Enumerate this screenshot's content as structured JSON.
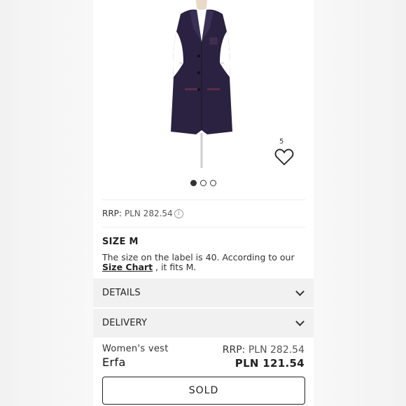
{
  "gallery": {
    "like_count": "5",
    "image_count": 3,
    "active_index": 0
  },
  "pricing_info": {
    "rrp_label": "RRP:",
    "rrp_value": "PLN 282.54",
    "info_icon": "info-icon"
  },
  "size": {
    "title": "SIZE M",
    "desc_before": "The size on the label is 40. According to our ",
    "link": "Size Chart",
    "desc_after": " , it fits M."
  },
  "accordions": [
    {
      "label": "DETAILS",
      "icon": "chevron-down-icon"
    },
    {
      "label": "DELIVERY",
      "icon": "chevron-down-icon"
    }
  ],
  "product": {
    "type": "Women's vest",
    "brand": "Erfa",
    "rrp_label": "RRP:",
    "rrp_value": "PLN 282.54",
    "price": "PLN 121.54"
  },
  "cta": {
    "label": "SOLD"
  },
  "colors": {
    "vest": "#2a2240",
    "accent_trim": "#5a2d4a"
  }
}
